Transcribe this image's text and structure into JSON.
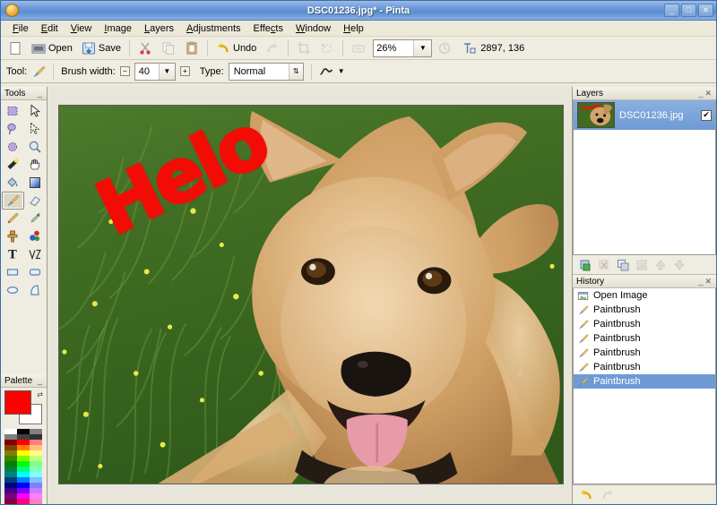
{
  "window": {
    "title": "DSC01236.jpg* - Pinta",
    "app_icon": "pinta-icon",
    "minimize_label": "_",
    "maximize_label": "□",
    "close_label": "✕"
  },
  "menubar": {
    "items": [
      {
        "label": "File",
        "mnemonic": "F"
      },
      {
        "label": "Edit",
        "mnemonic": "E"
      },
      {
        "label": "View",
        "mnemonic": "V"
      },
      {
        "label": "Image",
        "mnemonic": "I"
      },
      {
        "label": "Layers",
        "mnemonic": "L"
      },
      {
        "label": "Adjustments",
        "mnemonic": "A"
      },
      {
        "label": "Effects",
        "mnemonic": "c"
      },
      {
        "label": "Window",
        "mnemonic": "W"
      },
      {
        "label": "Help",
        "mnemonic": "H"
      }
    ]
  },
  "toolbar": {
    "new_label": "",
    "open_label": "Open",
    "save_label": "Save",
    "cut_label": "",
    "copy_label": "",
    "paste_label": "",
    "undo_label": "Undo",
    "redo_label": "",
    "crop_label": "",
    "deselect_label": "",
    "zoom_fit_label": "",
    "zoom_value": "26%",
    "zoom_caret": "▼",
    "zoom_reset_label": "",
    "cursor_coordinates": "2897, 136"
  },
  "tooloptions": {
    "tool_label": "Tool:",
    "tool_icon": "paintbrush-icon",
    "brush_width_label": "Brush width:",
    "brush_width_value": "40",
    "decrement_label": "−",
    "increment_label": "+",
    "type_label": "Type:",
    "type_value": "Normal",
    "blend_icon": "curve-icon",
    "caret": "▼"
  },
  "tools_panel": {
    "title": "Tools",
    "minimize_label": "_",
    "items": [
      {
        "name": "rectangle-select-icon",
        "label": "Rectangle Select"
      },
      {
        "name": "move-selected-icon",
        "label": "Move Selected"
      },
      {
        "name": "lasso-select-icon",
        "label": "Lasso Select"
      },
      {
        "name": "move-selection-icon",
        "label": "Move Selection"
      },
      {
        "name": "ellipse-select-icon",
        "label": "Ellipse Select"
      },
      {
        "name": "zoom-icon",
        "label": "Zoom"
      },
      {
        "name": "magic-wand-icon",
        "label": "Magic Wand Select"
      },
      {
        "name": "pan-icon",
        "label": "Pan"
      },
      {
        "name": "paint-bucket-icon",
        "label": "Paint Bucket"
      },
      {
        "name": "gradient-icon",
        "label": "Gradient"
      },
      {
        "name": "paintbrush-icon",
        "label": "Paintbrush"
      },
      {
        "name": "eraser-icon",
        "label": "Eraser"
      },
      {
        "name": "pencil-icon",
        "label": "Pencil"
      },
      {
        "name": "color-picker-icon",
        "label": "Color Picker"
      },
      {
        "name": "clone-stamp-icon",
        "label": "Clone Stamp"
      },
      {
        "name": "recolor-icon",
        "label": "Recolor"
      },
      {
        "name": "text-icon",
        "label": "Text"
      },
      {
        "name": "line-curve-icon",
        "label": "Line / Curve"
      },
      {
        "name": "rectangle-icon",
        "label": "Rectangle"
      },
      {
        "name": "rounded-rectangle-icon",
        "label": "Rounded Rectangle"
      },
      {
        "name": "ellipse-icon",
        "label": "Ellipse"
      },
      {
        "name": "freeform-shape-icon",
        "label": "Freeform Shape"
      }
    ],
    "selected_index": 10
  },
  "palette_panel": {
    "title": "Palette",
    "minimize_label": "_",
    "primary_color": "#ff0000",
    "secondary_color": "#ffffff",
    "swap_icon": "swap-colors-icon",
    "grid_colors": [
      "#ffffff",
      "#000000",
      "#808080",
      "#7f7f7f",
      "#404040",
      "#303030",
      "#800000",
      "#ff0000",
      "#ff8080",
      "#804000",
      "#ff8000",
      "#ffc080",
      "#808000",
      "#ffff00",
      "#ffff80",
      "#408000",
      "#80ff00",
      "#c0ff80",
      "#008000",
      "#00ff00",
      "#80ff80",
      "#008040",
      "#00ff80",
      "#80ffc0",
      "#008080",
      "#00ffff",
      "#80ffff",
      "#004080",
      "#0080ff",
      "#80c0ff",
      "#000080",
      "#0000ff",
      "#8080ff",
      "#400080",
      "#8000ff",
      "#c080ff",
      "#800080",
      "#ff00ff",
      "#ff80ff",
      "#800040",
      "#ff0080",
      "#ff80c0"
    ]
  },
  "layers_panel": {
    "title": "Layers",
    "minimize_label": "_",
    "close_label": "✕",
    "layers": [
      {
        "name": "DSC01236.jpg",
        "visible": true,
        "checkmark": "✔",
        "selected": true
      }
    ],
    "buttons": [
      {
        "name": "add-layer-button",
        "label": "Add Layer",
        "enabled": true
      },
      {
        "name": "delete-layer-button",
        "label": "Delete Layer",
        "enabled": false
      },
      {
        "name": "duplicate-layer-button",
        "label": "Duplicate Layer",
        "enabled": true
      },
      {
        "name": "merge-layer-down-button",
        "label": "Merge Layer Down",
        "enabled": false
      },
      {
        "name": "move-layer-up-button",
        "label": "Move Layer Up",
        "enabled": false
      },
      {
        "name": "move-layer-down-button",
        "label": "Move Layer Down",
        "enabled": false
      }
    ]
  },
  "history_panel": {
    "title": "History",
    "minimize_label": "_",
    "close_label": "✕",
    "entries": [
      {
        "icon": "open-image-icon",
        "label": "Open Image",
        "selected": false
      },
      {
        "icon": "paintbrush-icon",
        "label": "Paintbrush",
        "selected": false
      },
      {
        "icon": "paintbrush-icon",
        "label": "Paintbrush",
        "selected": false
      },
      {
        "icon": "paintbrush-icon",
        "label": "Paintbrush",
        "selected": false
      },
      {
        "icon": "paintbrush-icon",
        "label": "Paintbrush",
        "selected": false
      },
      {
        "icon": "paintbrush-icon",
        "label": "Paintbrush",
        "selected": false
      },
      {
        "icon": "paintbrush-icon",
        "label": "Paintbrush",
        "selected": true
      }
    ],
    "undo_label": "Undo",
    "redo_label": "Redo",
    "undo_enabled": true,
    "redo_enabled": false
  },
  "canvas": {
    "image_name": "DSC01236.jpg",
    "drawn_text": "Helo",
    "drawn_text_color": "#f30c06",
    "image_description": "photo of a tan puppy lying in green grass with small yellow flowers"
  }
}
